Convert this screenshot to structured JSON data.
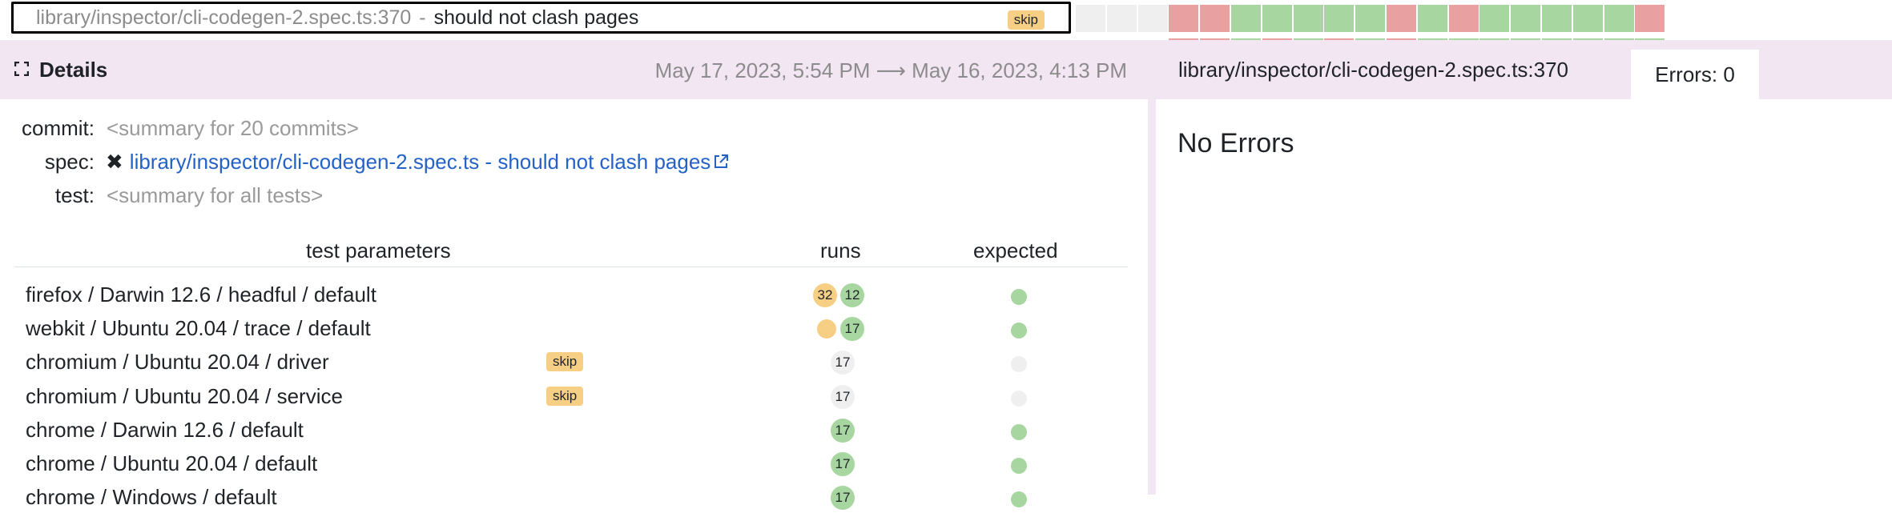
{
  "test_title": {
    "path": "library/inspector/cli-codegen-2.spec.ts:370",
    "separator": "-",
    "name": "should not clash pages",
    "badge": "skip"
  },
  "history": [
    "empty",
    "empty",
    "empty",
    "fail",
    "fail",
    "pass",
    "pass",
    "pass",
    "pass",
    "pass",
    "fail",
    "pass",
    "fail",
    "pass",
    "pass",
    "pass",
    "pass",
    "pass",
    "fail"
  ],
  "history_under": [
    "none",
    "none",
    "none",
    "fail",
    "fail",
    "pass",
    "fail",
    "pass",
    "fail",
    "pass",
    "fail",
    "pass",
    "pass",
    "pass",
    "pass",
    "pass",
    "pass",
    "pass",
    "pass"
  ],
  "details": {
    "title": "Details",
    "dates": "May 17, 2023, 5:54 PM ⟶ May 16, 2023, 4:13 PM"
  },
  "right_panel": {
    "path": "library/inspector/cli-codegen-2.spec.ts:370",
    "errors_tab": "Errors: 0",
    "no_errors": "No Errors"
  },
  "meta": {
    "commit_label": "commit:",
    "commit_value": "<summary for 20 commits>",
    "spec_label": "spec:",
    "spec_mark": "✖",
    "spec_value": "library/inspector/cli-codegen-2.spec.ts - should not clash pages",
    "test_label": "test:",
    "test_value": "<summary for all tests>"
  },
  "table": {
    "headers": {
      "params": "test parameters",
      "runs": "runs",
      "expected": "expected"
    },
    "rows": [
      {
        "label": "firefox / Darwin 12.6 / headful / default",
        "badge": "",
        "runs": [
          {
            "count": "32",
            "kind": "flaky"
          },
          {
            "count": "12",
            "kind": "pass"
          }
        ],
        "expected": "pass"
      },
      {
        "label": "webkit / Ubuntu 20.04 / trace / default",
        "badge": "",
        "runs": [
          {
            "count": "",
            "kind": "flaky"
          },
          {
            "count": "17",
            "kind": "pass"
          }
        ],
        "expected": "pass"
      },
      {
        "label": "chromium / Ubuntu 20.04 / driver",
        "badge": "skip",
        "runs": [
          {
            "count": "17",
            "kind": "skip"
          }
        ],
        "expected": "skip"
      },
      {
        "label": "chromium / Ubuntu 20.04 / service",
        "badge": "skip",
        "runs": [
          {
            "count": "17",
            "kind": "skip"
          }
        ],
        "expected": "skip"
      },
      {
        "label": "chrome / Darwin 12.6 / default",
        "badge": "",
        "runs": [
          {
            "count": "17",
            "kind": "pass"
          }
        ],
        "expected": "pass"
      },
      {
        "label": "chrome / Ubuntu 20.04 / default",
        "badge": "",
        "runs": [
          {
            "count": "17",
            "kind": "pass"
          }
        ],
        "expected": "pass"
      },
      {
        "label": "chrome / Windows / default",
        "badge": "",
        "runs": [
          {
            "count": "17",
            "kind": "pass"
          }
        ],
        "expected": "pass"
      }
    ]
  },
  "colors": {
    "pass": "#a8d6a0",
    "fail": "#e8a0a0",
    "flaky": "#f6cf84",
    "skip": "#efefef",
    "empty": "#efefef",
    "header_bg": "#f3e6f3",
    "link": "#2462c6"
  }
}
